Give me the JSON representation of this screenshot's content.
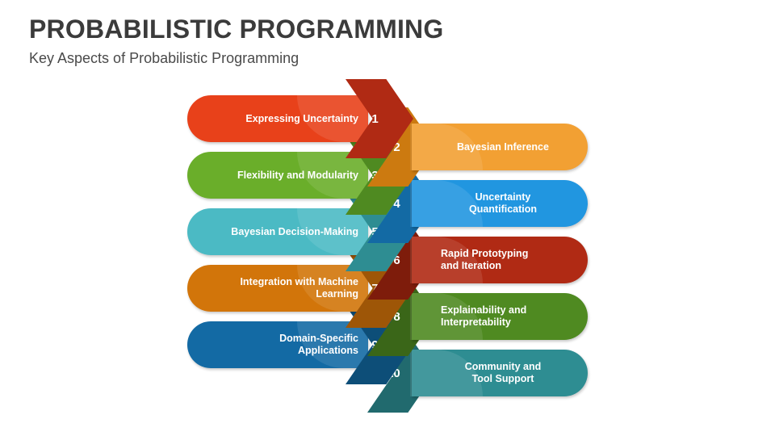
{
  "header": {
    "title": "PROBABILISTIC PROGRAMMING",
    "subtitle": "Key Aspects of Probabilistic Programming",
    "title_color": "#3b3b3b",
    "subtitle_color": "#4a4a4a"
  },
  "diagram": {
    "type": "interlocking-arrow-list",
    "items": [
      {
        "number": "01",
        "label": "Expressing Uncertainty",
        "side": "left",
        "bar_color": "#E8411A",
        "head_color": "#B02A14",
        "align": "right"
      },
      {
        "number": "02",
        "label": "Bayesian Inference",
        "side": "right",
        "bar_color": "#F2A033",
        "head_color": "#CC7A10",
        "align": "center"
      },
      {
        "number": "03",
        "label": "Flexibility and Modularity",
        "side": "left",
        "bar_color": "#6AAE2A",
        "head_color": "#4F8A21",
        "align": "right"
      },
      {
        "number": "04",
        "label": "Uncertainty Quantification",
        "side": "right",
        "bar_color": "#2196E0",
        "head_color": "#136AA4",
        "align": "center"
      },
      {
        "number": "05",
        "label": "Bayesian Decision-Making",
        "side": "left",
        "bar_color": "#4BBAC4",
        "head_color": "#2E8D92",
        "align": "right"
      },
      {
        "number": "06",
        "label": "Rapid Prototyping\nand Iteration",
        "side": "right",
        "bar_color": "#B02A14",
        "head_color": "#7E1C0B",
        "align": "left"
      },
      {
        "number": "07",
        "label": "Integration with Machine\nLearning",
        "side": "left",
        "bar_color": "#D2750A",
        "head_color": "#9E5607",
        "align": "right"
      },
      {
        "number": "08",
        "label": "Explainability and\nInterpretability",
        "side": "right",
        "bar_color": "#4F8A21",
        "head_color": "#3A6618",
        "align": "left"
      },
      {
        "number": "09",
        "label": "Domain-Specific\nApplications",
        "side": "left",
        "bar_color": "#136AA4",
        "head_color": "#0D4E78",
        "align": "right"
      },
      {
        "number": "10",
        "label": "Community and\nTool Support",
        "side": "right",
        "bar_color": "#2E8D92",
        "head_color": "#216A6E",
        "align": "center"
      }
    ]
  }
}
